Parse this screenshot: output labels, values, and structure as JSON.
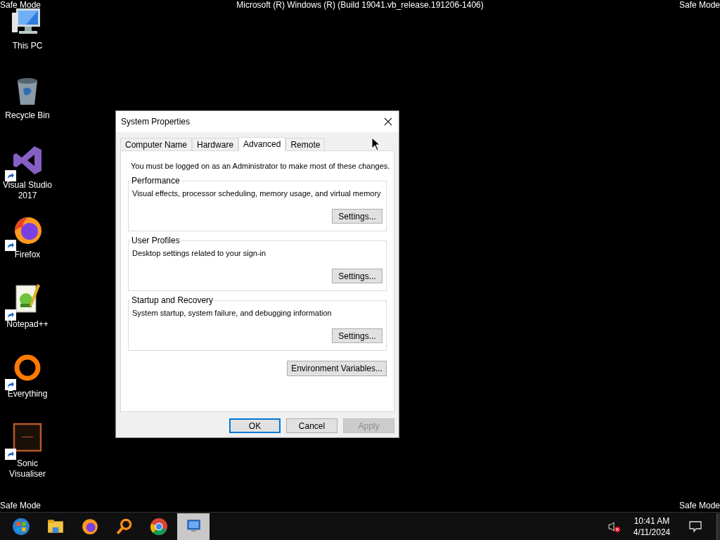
{
  "overlay": {
    "top_left": "Safe Mode",
    "top_center": "Microsoft (R) Windows (R) (Build 19041.vb_release.191206-1406)",
    "top_right": "Safe Mode",
    "bottom_left": "Safe Mode",
    "bottom_right": "Safe Mode"
  },
  "desktop_icons": [
    {
      "kind": "pc",
      "label": "This PC",
      "shortcut": false
    },
    {
      "kind": "bin",
      "label": "Recycle Bin",
      "shortcut": false
    },
    {
      "kind": "vs",
      "label": "Visual Studio 2017",
      "shortcut": true
    },
    {
      "kind": "firefox",
      "label": "Firefox",
      "shortcut": true
    },
    {
      "kind": "notepad",
      "label": "Notepad++",
      "shortcut": true
    },
    {
      "kind": "ring",
      "label": "Everything",
      "shortcut": true
    },
    {
      "kind": "frame",
      "label": "Sonic Visualiser",
      "shortcut": true
    }
  ],
  "dialog": {
    "title": "System Properties",
    "tabs": [
      {
        "label": "Computer Name",
        "selected": false
      },
      {
        "label": "Hardware",
        "selected": false
      },
      {
        "label": "Advanced",
        "selected": true
      },
      {
        "label": "Remote",
        "selected": false
      }
    ],
    "note": "You must be logged on as an Administrator to make most of these changes.",
    "groups": [
      {
        "label": "Performance",
        "description": "Visual effects, processor scheduling, memory usage, and virtual memory",
        "button": "Settings..."
      },
      {
        "label": "User Profiles",
        "description": "Desktop settings related to your sign-in",
        "button": "Settings..."
      },
      {
        "label": "Startup and Recovery",
        "description": "System startup, system failure, and debugging information",
        "button": "Settings..."
      }
    ],
    "env_button": "Environment Variables...",
    "buttons": [
      {
        "label": "OK",
        "default": true,
        "disabled": false
      },
      {
        "label": "Cancel",
        "default": false,
        "disabled": false
      },
      {
        "label": "Apply",
        "default": false,
        "disabled": true
      }
    ]
  },
  "taskbar": {
    "items": [
      {
        "kind": "start",
        "selected": false
      },
      {
        "kind": "folder",
        "selected": false
      },
      {
        "kind": "firefox",
        "selected": false
      },
      {
        "kind": "search",
        "selected": false
      },
      {
        "kind": "chrome",
        "selected": false
      },
      {
        "kind": "system",
        "selected": true
      }
    ],
    "volume_muted": true,
    "time": "10:41 AM",
    "date": "4/11/2024"
  }
}
